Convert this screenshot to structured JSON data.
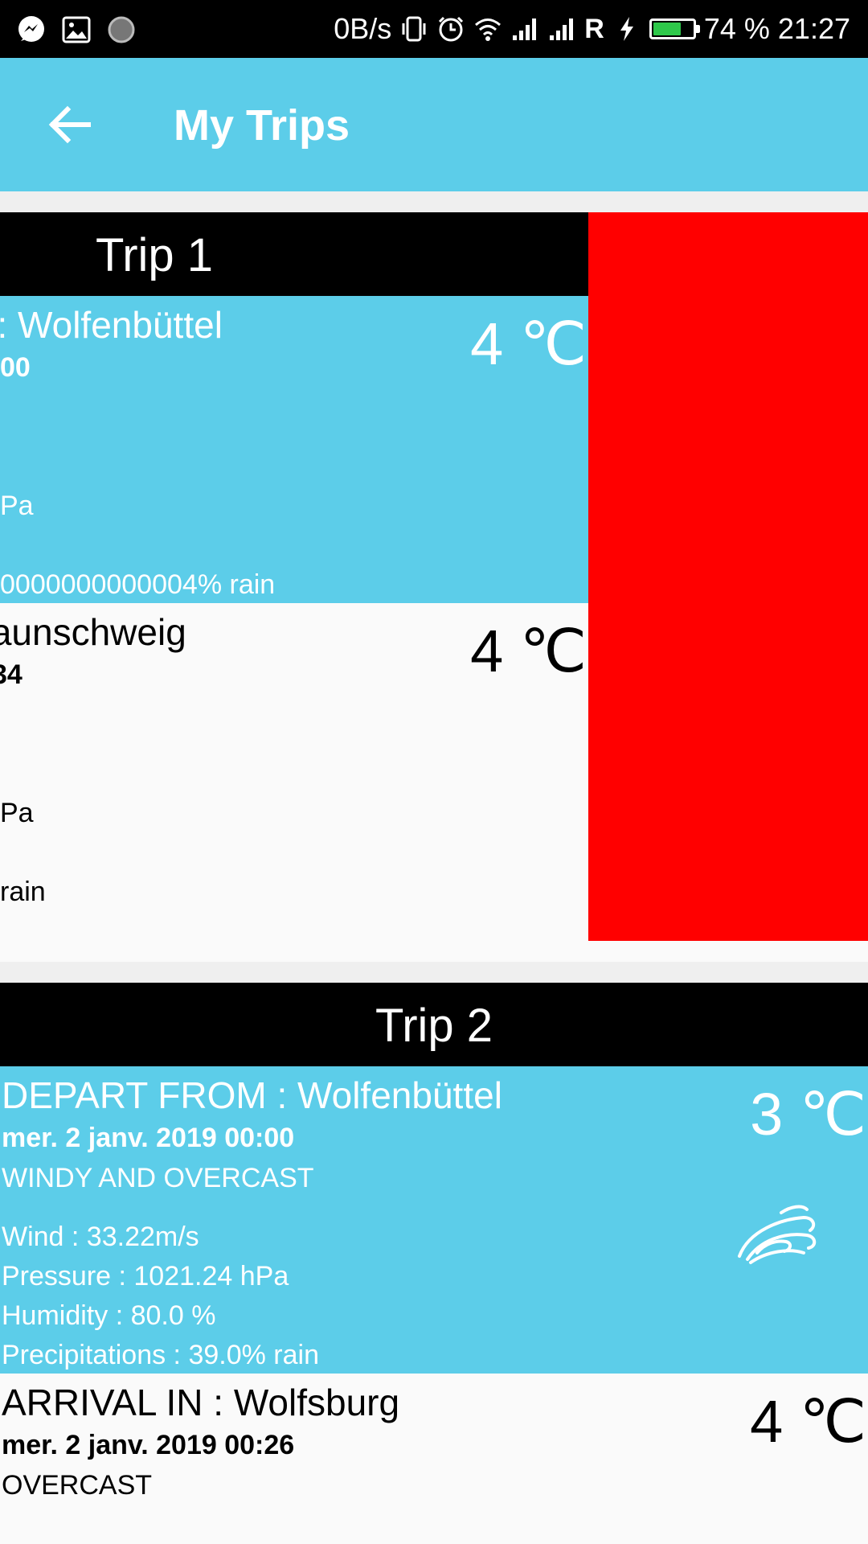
{
  "status_bar": {
    "net_speed": "0B/s",
    "roaming": "R",
    "battery_percent": "74 %",
    "battery_level": 0.74,
    "time": "21:27",
    "icons": [
      "messenger-icon",
      "gallery-icon",
      "loading-icon",
      "vibrate-icon",
      "alarm-icon",
      "wifi-icon",
      "signal-icon",
      "signal-icon",
      "charging-icon",
      "battery-icon"
    ]
  },
  "app_bar": {
    "title": "My Trips",
    "back_icon": "arrow-left-icon"
  },
  "colors": {
    "app_bar": "#5ccde9",
    "trip_header": "#000000",
    "depart_bg": "#5ccde9",
    "arrive_bg": "#fafafa",
    "delete_action": "#ff0000"
  },
  "trips": [
    {
      "header": "Trip 1",
      "depart": {
        "location": "DEPART FROM : Wolfenbüttel",
        "datetime": "00",
        "condition": "",
        "wind": "",
        "pressure": "Pa",
        "humidity": "",
        "precipitations": "0000000000004% rain",
        "temp": "4 ℃"
      },
      "arrive": {
        "location": "ARRIVAL IN : Braunschweig",
        "datetime": "34",
        "condition": "",
        "wind": "",
        "pressure": "Pa",
        "humidity": "",
        "precipitations": " rain",
        "temp": "4 ℃"
      },
      "swipe_action_color": "#ff0000"
    },
    {
      "header": "Trip 2",
      "depart": {
        "location": "DEPART FROM : Wolfenbüttel",
        "datetime": "mer. 2 janv. 2019 00:00",
        "condition": "WINDY AND OVERCAST",
        "wind": "Wind : 33.22m/s",
        "pressure": "Pressure : 1021.24 hPa",
        "humidity": "Humidity : 80.0 %",
        "precipitations": "Precipitations : 39.0% rain",
        "temp": "3 ℃",
        "icon": "wind-icon"
      },
      "arrive": {
        "location": "ARRIVAL IN : Wolfsburg",
        "datetime": "mer. 2 janv. 2019 00:26",
        "condition": "OVERCAST",
        "temp": "4 ℃",
        "icon": "cloud-icon"
      }
    }
  ]
}
